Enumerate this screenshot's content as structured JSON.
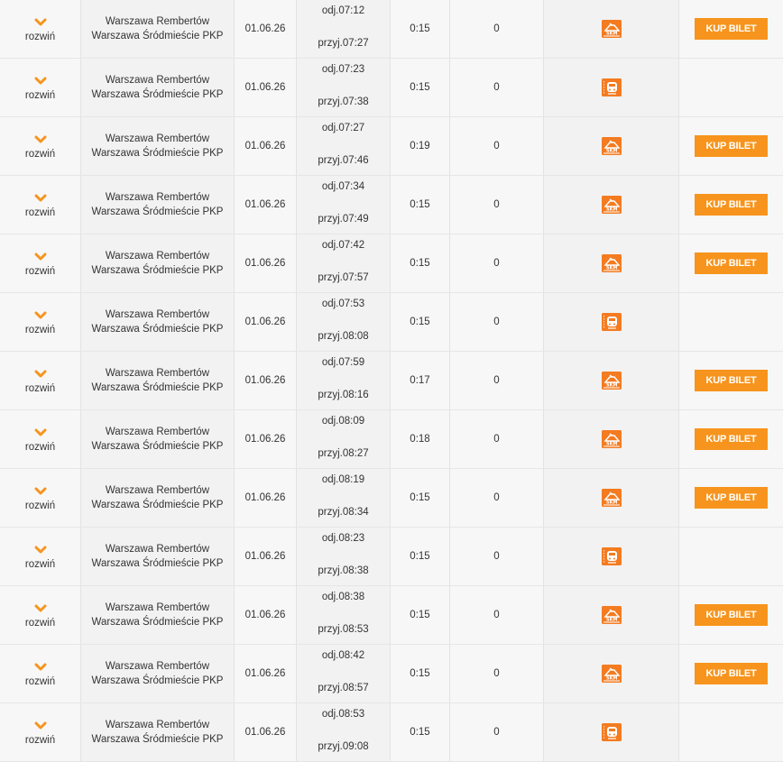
{
  "expand_label": "rozwiń",
  "buy_label": "KUP BILET",
  "colors": {
    "accent": "#f7941d",
    "icon": "#f47b20"
  },
  "rows": [
    {
      "from": "Warszawa Rembertów",
      "to": "Warszawa Śródmieście PKP",
      "date": "01.06.26",
      "dep": "odj.07:12",
      "arr": "przyj.07:27",
      "duration": "0:15",
      "changes": "0",
      "carrier_icon": "skm-train-icon",
      "buy": true
    },
    {
      "from": "Warszawa Rembertów",
      "to": "Warszawa Śródmieście PKP",
      "date": "01.06.26",
      "dep": "odj.07:23",
      "arr": "przyj.07:38",
      "duration": "0:15",
      "changes": "0",
      "carrier_icon": "regional-train-icon",
      "buy": false
    },
    {
      "from": "Warszawa Rembertów",
      "to": "Warszawa Śródmieście PKP",
      "date": "01.06.26",
      "dep": "odj.07:27",
      "arr": "przyj.07:46",
      "duration": "0:19",
      "changes": "0",
      "carrier_icon": "skm-train-icon",
      "buy": true
    },
    {
      "from": "Warszawa Rembertów",
      "to": "Warszawa Śródmieście PKP",
      "date": "01.06.26",
      "dep": "odj.07:34",
      "arr": "przyj.07:49",
      "duration": "0:15",
      "changes": "0",
      "carrier_icon": "skm-train-icon",
      "buy": true
    },
    {
      "from": "Warszawa Rembertów",
      "to": "Warszawa Śródmieście PKP",
      "date": "01.06.26",
      "dep": "odj.07:42",
      "arr": "przyj.07:57",
      "duration": "0:15",
      "changes": "0",
      "carrier_icon": "skm-train-icon",
      "buy": true
    },
    {
      "from": "Warszawa Rembertów",
      "to": "Warszawa Śródmieście PKP",
      "date": "01.06.26",
      "dep": "odj.07:53",
      "arr": "przyj.08:08",
      "duration": "0:15",
      "changes": "0",
      "carrier_icon": "regional-train-icon",
      "buy": false
    },
    {
      "from": "Warszawa Rembertów",
      "to": "Warszawa Śródmieście PKP",
      "date": "01.06.26",
      "dep": "odj.07:59",
      "arr": "przyj.08:16",
      "duration": "0:17",
      "changes": "0",
      "carrier_icon": "skm-train-icon",
      "buy": true
    },
    {
      "from": "Warszawa Rembertów",
      "to": "Warszawa Śródmieście PKP",
      "date": "01.06.26",
      "dep": "odj.08:09",
      "arr": "przyj.08:27",
      "duration": "0:18",
      "changes": "0",
      "carrier_icon": "skm-train-icon",
      "buy": true
    },
    {
      "from": "Warszawa Rembertów",
      "to": "Warszawa Śródmieście PKP",
      "date": "01.06.26",
      "dep": "odj.08:19",
      "arr": "przyj.08:34",
      "duration": "0:15",
      "changes": "0",
      "carrier_icon": "skm-train-icon",
      "buy": true
    },
    {
      "from": "Warszawa Rembertów",
      "to": "Warszawa Śródmieście PKP",
      "date": "01.06.26",
      "dep": "odj.08:23",
      "arr": "przyj.08:38",
      "duration": "0:15",
      "changes": "0",
      "carrier_icon": "regional-train-icon",
      "buy": false
    },
    {
      "from": "Warszawa Rembertów",
      "to": "Warszawa Śródmieście PKP",
      "date": "01.06.26",
      "dep": "odj.08:38",
      "arr": "przyj.08:53",
      "duration": "0:15",
      "changes": "0",
      "carrier_icon": "skm-train-icon",
      "buy": true
    },
    {
      "from": "Warszawa Rembertów",
      "to": "Warszawa Śródmieście PKP",
      "date": "01.06.26",
      "dep": "odj.08:42",
      "arr": "przyj.08:57",
      "duration": "0:15",
      "changes": "0",
      "carrier_icon": "skm-train-icon",
      "buy": true
    },
    {
      "from": "Warszawa Rembertów",
      "to": "Warszawa Śródmieście PKP",
      "date": "01.06.26",
      "dep": "odj.08:53",
      "arr": "przyj.09:08",
      "duration": "0:15",
      "changes": "0",
      "carrier_icon": "regional-train-icon",
      "buy": false
    }
  ]
}
